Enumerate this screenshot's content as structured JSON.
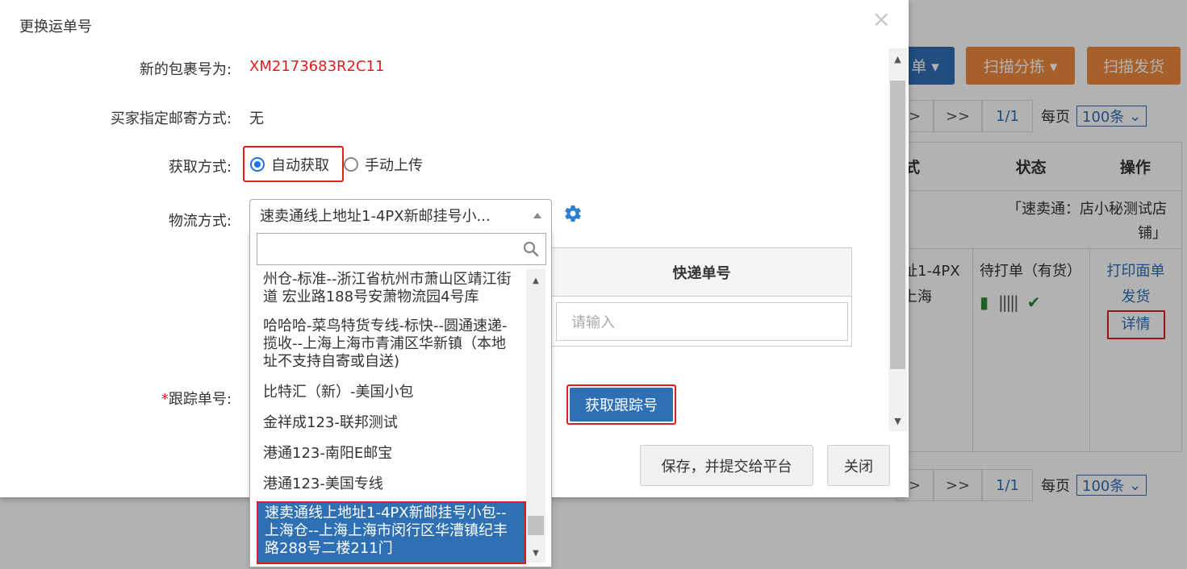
{
  "background": {
    "buttons": [
      "单 ▾",
      "扫描分拣 ▾",
      "扫描发货"
    ],
    "pager_top": {
      "prev": ">",
      "last": ">>",
      "page": "1/1",
      "per_page_label": "每页",
      "per_page_value": "100条"
    },
    "pager_bottom": {
      "prev": ">",
      "last": ">>",
      "page": "1/1",
      "per_page_label": "每页",
      "per_page_value": "100条"
    },
    "table": {
      "headers": [
        "式",
        "状态",
        "操作"
      ],
      "shop_line1": "「速卖通：店小秘测试店",
      "shop_line2": "铺」",
      "row_col1_line1": "址1-4PX",
      "row_col1_line2": "上海",
      "row_status": "待打单（有货）",
      "actions": [
        "打印面单",
        "发货",
        "详情"
      ]
    }
  },
  "modal": {
    "title": "更换运单号",
    "close": "×",
    "fields": {
      "new_package_label": "新的包裹号为:",
      "new_package_value": "XM2173683R2C11",
      "buyer_method_label": "买家指定邮寄方式:",
      "buyer_method_value": "无",
      "acquire_label": "获取方式:",
      "acquire_options": [
        "自动获取",
        "手动上传"
      ],
      "acquire_selected": "自动获取",
      "logistics_label": "物流方式:",
      "logistics_selected": "速卖通线上地址1-4PX新邮挂号小...",
      "tracking_required_mark": "*",
      "tracking_label": "跟踪单号:"
    },
    "table": {
      "header": "快递单号",
      "input_placeholder": "请输入"
    },
    "get_tracking_button": "获取跟踪号",
    "save_button": "保存，并提交给平台",
    "close_button": "关闭"
  },
  "dropdown": {
    "search_value": "",
    "options": [
      "州仓-标准--浙江省杭州市萧山区靖江街道 宏业路188号安萧物流园4号库",
      "哈哈哈-菜鸟特货专线-标快--圆通速递-揽收--上海上海市青浦区华新镇（本地址不支持自寄或自送)",
      "比特汇（新）-美国小包",
      "金祥成123-联邦测试",
      "港通123-南阳E邮宝",
      "港通123-美国专线",
      "速卖通线上地址1-4PX新邮挂号小包--上海仓--上海上海市闵行区华漕镇纪丰路288号二楼211门"
    ],
    "selected_index": 6
  }
}
